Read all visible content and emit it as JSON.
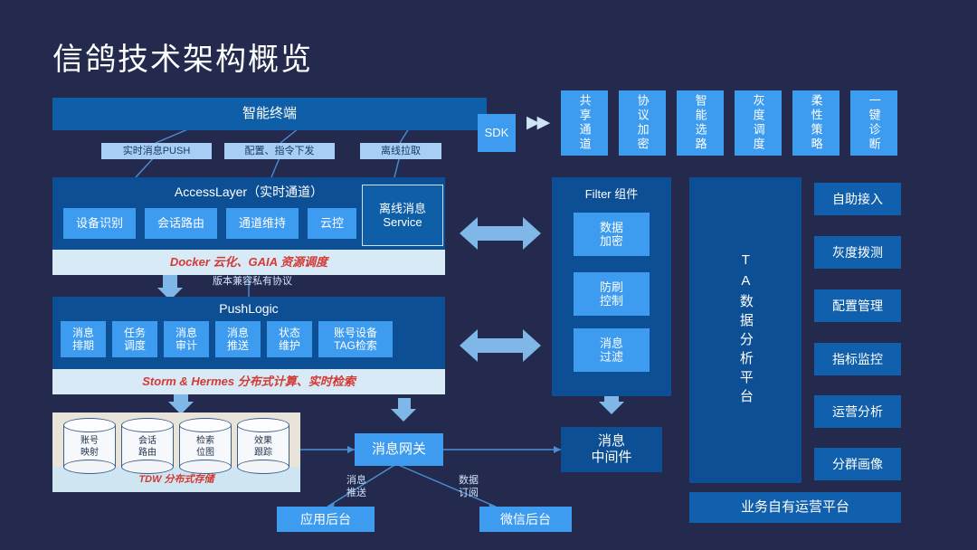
{
  "page": {
    "title": "信鸽技术架构概览",
    "background_color": "#232a4d",
    "accent_deep": "#0f5fa8",
    "accent_light": "#3d9bf0",
    "accent_pale": "#a8cef5",
    "banner_text_color": "#d33a33"
  },
  "terminal": {
    "label": "智能终端",
    "sdk_label": "SDK",
    "forward_icon": "double-chevron-right-icon"
  },
  "terminal_links": [
    {
      "label": "实时消息PUSH"
    },
    {
      "label": "配置、指令下发"
    },
    {
      "label": "离线拉取"
    }
  ],
  "capability_boxes": [
    {
      "label": "共享通道"
    },
    {
      "label": "协议加密"
    },
    {
      "label": "智能选路"
    },
    {
      "label": "灰度调度"
    },
    {
      "label": "柔性策略"
    },
    {
      "label": "一键诊断"
    }
  ],
  "access_layer": {
    "title": "AccessLayer（实时通道）",
    "modules": [
      {
        "label": "设备识别"
      },
      {
        "label": "会话路由"
      },
      {
        "label": "通道维持"
      },
      {
        "label": "云控"
      }
    ],
    "banner": "Docker 云化、GAIA 资源调度",
    "side_box": {
      "line1": "离线消息",
      "line2": "Service"
    }
  },
  "protocol_note": "版本兼容私有协议",
  "push_logic": {
    "title": "PushLogic",
    "modules": [
      {
        "line1": "消息",
        "line2": "排期"
      },
      {
        "line1": "任务",
        "line2": "调度"
      },
      {
        "line1": "消息",
        "line2": "审计"
      },
      {
        "line1": "消息",
        "line2": "推送"
      },
      {
        "line1": "状态",
        "line2": "维护"
      },
      {
        "line1": "账号设备",
        "line2": "TAG检索"
      }
    ],
    "banner": "Storm & Hermes 分布式计算、实时检索"
  },
  "filter_panel": {
    "title": "Filter 组件",
    "modules": [
      {
        "line1": "数据",
        "line2": "加密"
      },
      {
        "line1": "防刷",
        "line2": "控制"
      },
      {
        "line1": "消息",
        "line2": "过滤"
      }
    ]
  },
  "ta_platform": {
    "label": "TA数据分析平台"
  },
  "ops_buttons": [
    {
      "label": "自助接入"
    },
    {
      "label": "灰度拨测"
    },
    {
      "label": "配置管理"
    },
    {
      "label": "指标监控"
    },
    {
      "label": "运营分析"
    },
    {
      "label": "分群画像"
    }
  ],
  "business_platform": {
    "label": "业务自有运营平台"
  },
  "storage": {
    "banner": "TDW 分布式存储",
    "stores": [
      {
        "line1": "账号",
        "line2": "映射"
      },
      {
        "line1": "会话",
        "line2": "路由"
      },
      {
        "line1": "检索",
        "line2": "位图"
      },
      {
        "line1": "效果",
        "line2": "跟踪"
      }
    ]
  },
  "gateway": {
    "label": "消息网关"
  },
  "middleware": {
    "line1": "消息",
    "line2": "中间件"
  },
  "gateway_links": [
    {
      "line1": "消息",
      "line2": "推送"
    },
    {
      "line1": "数据",
      "line2": "订阅"
    }
  ],
  "backends": [
    {
      "label": "应用后台"
    },
    {
      "label": "微信后台"
    }
  ]
}
